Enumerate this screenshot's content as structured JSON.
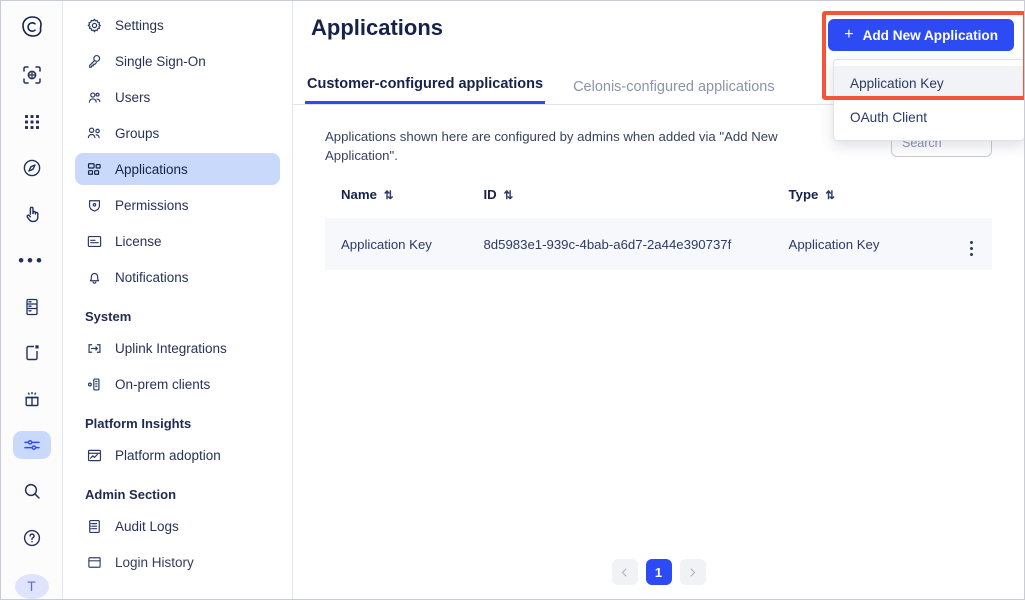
{
  "rail": {
    "items": [
      {
        "name": "celonis-logo",
        "icon": "celonis-logo-icon"
      },
      {
        "name": "process-explorer",
        "icon": "scan-process-icon"
      },
      {
        "name": "apps-grid",
        "icon": "grid-dots-icon"
      },
      {
        "name": "navigator",
        "icon": "compass-icon"
      },
      {
        "name": "action-flows",
        "icon": "hand-click-icon"
      },
      {
        "name": "more",
        "icon": "ellipsis-icon"
      },
      {
        "name": "data-tables",
        "icon": "server-icon"
      },
      {
        "name": "new-document",
        "icon": "document-new-icon"
      },
      {
        "name": "marketplace",
        "icon": "gift-icon"
      },
      {
        "name": "admin-settings",
        "icon": "sliders-icon"
      },
      {
        "name": "search",
        "icon": "search-icon"
      },
      {
        "name": "help",
        "icon": "question-circle-icon"
      }
    ],
    "avatar_initial": "T"
  },
  "sidebar": {
    "items": [
      {
        "label": "Settings",
        "icon": "gear-icon",
        "active": false
      },
      {
        "label": "Single Sign-On",
        "icon": "key-icon",
        "active": false
      },
      {
        "label": "Users",
        "icon": "users-icon",
        "active": false
      },
      {
        "label": "Groups",
        "icon": "group-icon",
        "active": false
      },
      {
        "label": "Applications",
        "icon": "applications-icon",
        "active": true
      },
      {
        "label": "Permissions",
        "icon": "shield-icon",
        "active": false
      },
      {
        "label": "License",
        "icon": "license-card-icon",
        "active": false
      },
      {
        "label": "Notifications",
        "icon": "bell-icon",
        "active": false
      }
    ],
    "groups": [
      {
        "title": "System",
        "items": [
          {
            "label": "Uplink Integrations",
            "icon": "uplink-icon"
          },
          {
            "label": "On-prem clients",
            "icon": "onprem-icon"
          }
        ]
      },
      {
        "title": "Platform Insights",
        "items": [
          {
            "label": "Platform adoption",
            "icon": "chart-image-icon"
          }
        ]
      },
      {
        "title": "Admin Section",
        "items": [
          {
            "label": "Audit Logs",
            "icon": "audit-log-icon"
          },
          {
            "label": "Login History",
            "icon": "login-history-icon"
          }
        ]
      }
    ],
    "collapse_toggle": "collapse-sidebar-icon"
  },
  "header": {
    "title": "Applications",
    "add_button": {
      "label": "Add New Application",
      "icon": "plus-icon"
    },
    "dropdown": {
      "items": [
        {
          "label": "Application Key",
          "hover": true
        },
        {
          "label": "OAuth Client",
          "hover": false
        }
      ]
    }
  },
  "tabs": [
    {
      "label": "Customer-configured applications",
      "active": true
    },
    {
      "label": "Celonis-configured applications",
      "active": false
    }
  ],
  "content": {
    "description": "Applications shown here are configured by admins when added via \"Add New Application\".",
    "search": {
      "placeholder": "Search",
      "value": "",
      "icon": "search-icon"
    },
    "table": {
      "columns": [
        {
          "label": "Name",
          "sort_icon": "sort-icon"
        },
        {
          "label": "ID",
          "sort_icon": "sort-icon"
        },
        {
          "label": "Type",
          "sort_icon": "sort-icon"
        },
        {
          "label": "",
          "sort_icon": ""
        }
      ],
      "rows": [
        {
          "name": "Application Key",
          "id": "8d5983e1-939c-4bab-a6d7-2a44e390737f",
          "type": "Application Key",
          "actions_icon": "kebab-menu-icon"
        }
      ]
    },
    "pagination": {
      "prev_icon": "chevron-left-icon",
      "next_icon": "chevron-right-icon",
      "pages": [
        "1"
      ],
      "current": "1"
    }
  },
  "colors": {
    "accent": "#2d4bf5",
    "highlight": "#f4533c",
    "active_nav_bg": "#c9d9fb",
    "row_bg": "#f7f8fb",
    "text": "#17224a"
  }
}
